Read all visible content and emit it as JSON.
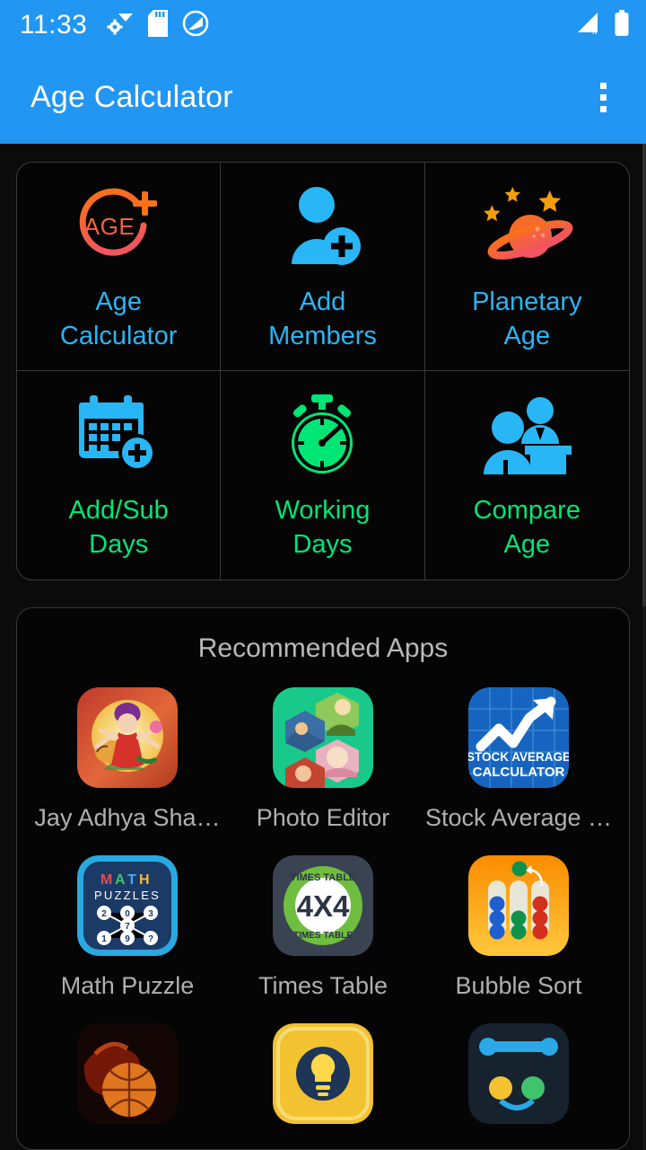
{
  "status_bar": {
    "time": "11:33",
    "left_icons": [
      "wifi-settings-icon",
      "sd-card-icon",
      "do-not-disturb-icon"
    ],
    "right_icons": [
      "signal-off-icon",
      "battery-full-icon"
    ],
    "background": "#2196F3"
  },
  "app_bar": {
    "title": "Age Calculator",
    "overflow_menu": "more-options",
    "background": "#2196F3"
  },
  "features": {
    "items": [
      {
        "label": "Age\nCalculator",
        "line1": "Age",
        "line2": "Calculator",
        "icon": "age-circle-plus-icon",
        "label_color": "#29b6f6"
      },
      {
        "label": "Add\nMembers",
        "line1": "Add",
        "line2": "Members",
        "icon": "person-add-icon",
        "label_color": "#29b6f6"
      },
      {
        "label": "Planetary\nAge",
        "line1": "Planetary",
        "line2": "Age",
        "icon": "planet-saturn-icon",
        "label_color": "#29b6f6"
      },
      {
        "label": "Add/Sub\nDays",
        "line1": "Add/Sub",
        "line2": "Days",
        "icon": "calendar-plus-icon",
        "label_color": "#00e676"
      },
      {
        "label": "Working\nDays",
        "line1": "Working",
        "line2": "Days",
        "icon": "stopwatch-icon",
        "label_color": "#00e676"
      },
      {
        "label": "Compare\nAge",
        "line1": "Compare",
        "line2": "Age",
        "icon": "people-desk-icon",
        "label_color": "#00e676"
      }
    ]
  },
  "recommended": {
    "title": "Recommended Apps",
    "apps": [
      {
        "label": "Jay Adhya Sha…",
        "icon": "deity-durga-app-icon"
      },
      {
        "label": "Photo Editor",
        "icon": "photo-collage-app-icon"
      },
      {
        "label": "Stock Average …",
        "icon": "stock-average-calculator-app-icon",
        "icon_text_1": "STOCK AVERAGE",
        "icon_text_2": "CALCULATOR"
      },
      {
        "label": "Math Puzzle",
        "icon": "math-puzzles-app-icon",
        "icon_text_1": "MATH",
        "icon_text_2": "PUZZLES",
        "icon_numbers": [
          "2",
          "0",
          "3",
          "7",
          "1",
          "9",
          "?"
        ]
      },
      {
        "label": "Times Table",
        "icon": "times-table-app-icon",
        "icon_text_1": "TIMES TABLE",
        "icon_text_2": "4X4",
        "icon_text_3": "TIMES TABLE"
      },
      {
        "label": "Bubble Sort",
        "icon": "bubble-sort-app-icon"
      },
      {
        "label": "",
        "icon": "basketball-fire-app-icon"
      },
      {
        "label": "",
        "icon": "lightbulb-quiz-app-icon"
      },
      {
        "label": "",
        "icon": "connect-dots-app-icon"
      }
    ]
  },
  "theme": {
    "accent": "#2196F3",
    "background": "#0b0b0b",
    "card_background": "#050505",
    "card_border": "#3a3a3a",
    "label_blue": "#29b6f6",
    "label_green": "#00e676",
    "text_muted": "#b0b0b0"
  }
}
